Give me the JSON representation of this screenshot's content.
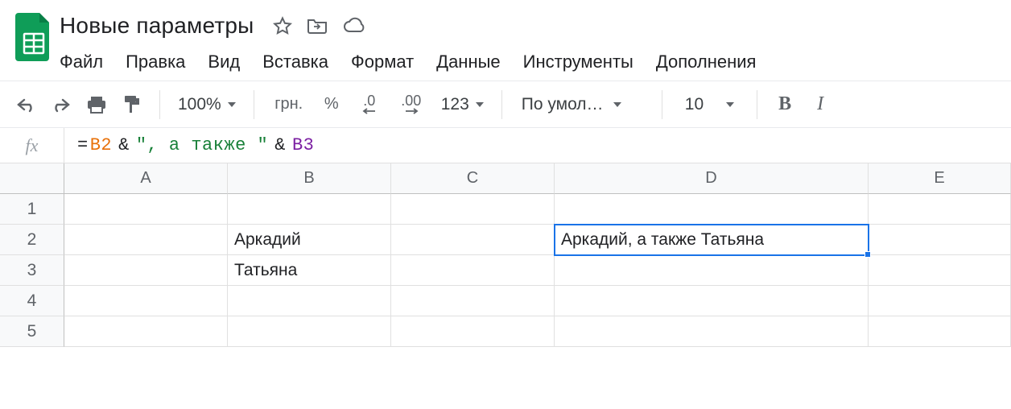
{
  "doc": {
    "title": "Новые параметры"
  },
  "menu": {
    "file": "Файл",
    "edit": "Правка",
    "view": "Вид",
    "insert": "Вставка",
    "format": "Формат",
    "data": "Данные",
    "tools": "Инструменты",
    "addons": "Дополнения"
  },
  "toolbar": {
    "zoom": "100%",
    "currency": "грн.",
    "percent": "%",
    "dec_dec": ".0",
    "inc_dec": ".00",
    "more_formats": "123",
    "font": "По умол…",
    "font_size": "10"
  },
  "fx": {
    "eq": "=",
    "ref1": "B2",
    "amp": "&",
    "str": "\", а также \"",
    "ref2": "B3"
  },
  "columns": [
    "A",
    "B",
    "C",
    "D",
    "E"
  ],
  "rows": [
    "1",
    "2",
    "3",
    "4",
    "5"
  ],
  "cells": {
    "B2": "Аркадий",
    "B3": "Татьяна",
    "D2": "Аркадий, а также Татьяна"
  },
  "selected": "D2"
}
